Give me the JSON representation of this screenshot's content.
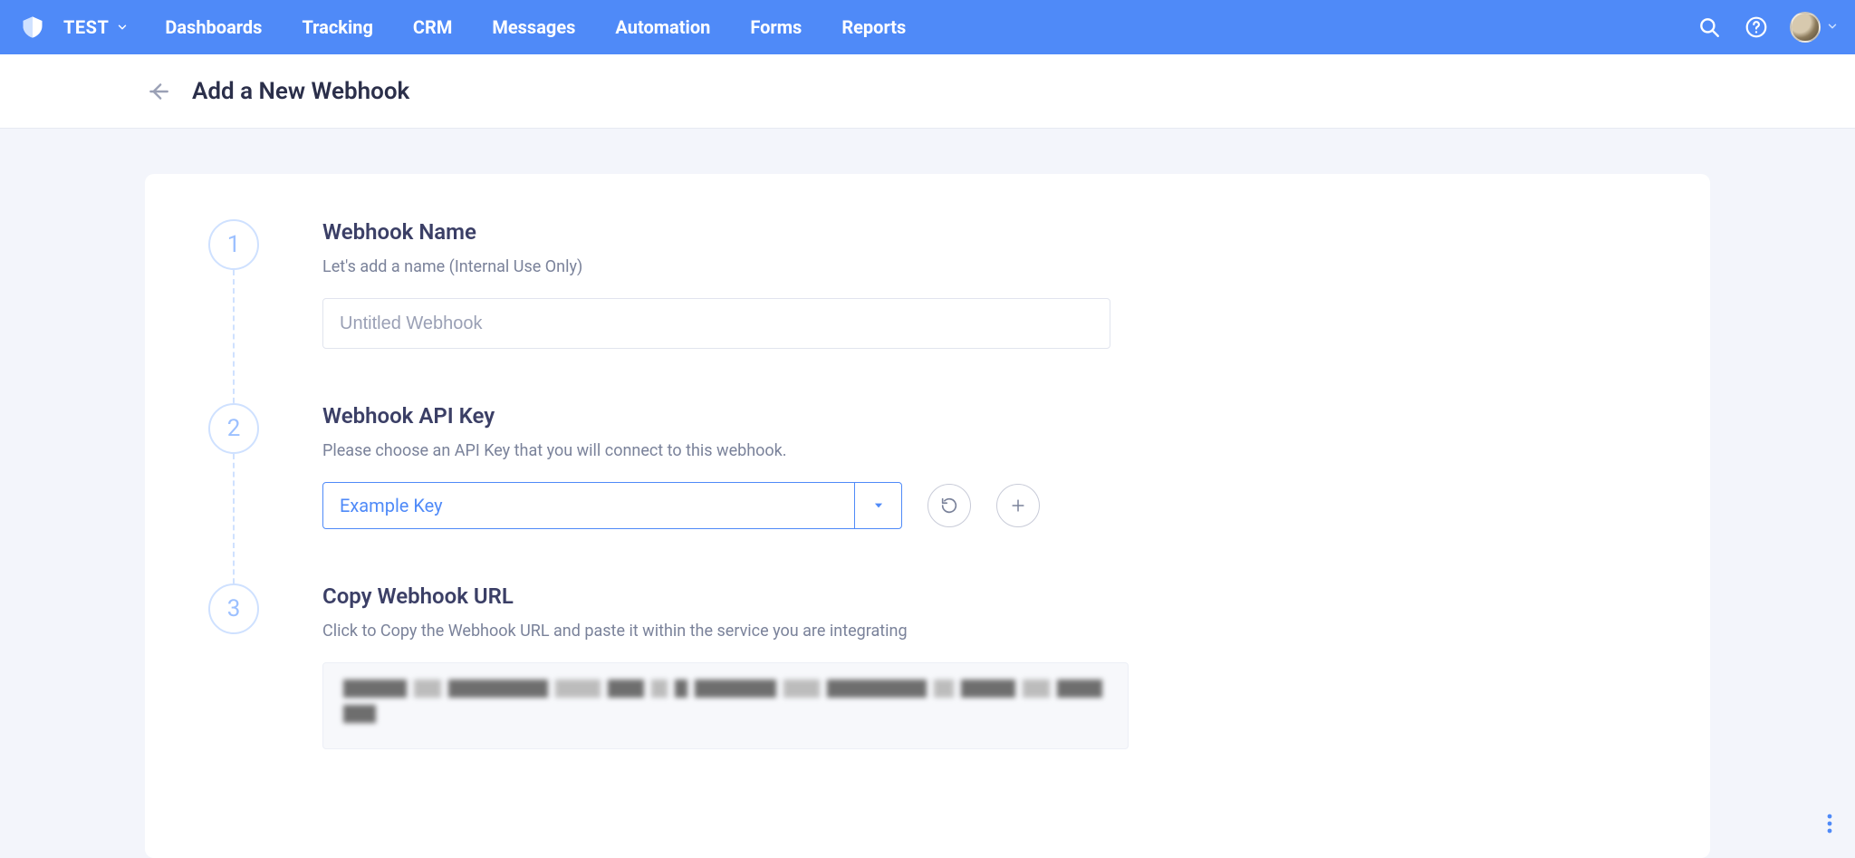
{
  "navbar": {
    "workspace": "TEST",
    "items": [
      "Dashboards",
      "Tracking",
      "CRM",
      "Messages",
      "Automation",
      "Forms",
      "Reports"
    ]
  },
  "page": {
    "title": "Add a New Webhook"
  },
  "steps": [
    {
      "num": "1",
      "title": "Webhook Name",
      "desc": "Let's add a name (Internal Use Only)",
      "input_placeholder": "Untitled Webhook"
    },
    {
      "num": "2",
      "title": "Webhook API Key",
      "desc": "Please choose an API Key that you will connect to this webhook.",
      "select_value": "Example Key"
    },
    {
      "num": "3",
      "title": "Copy Webhook URL",
      "desc": "Click to Copy the Webhook URL and paste it within the service you are integrating"
    }
  ]
}
